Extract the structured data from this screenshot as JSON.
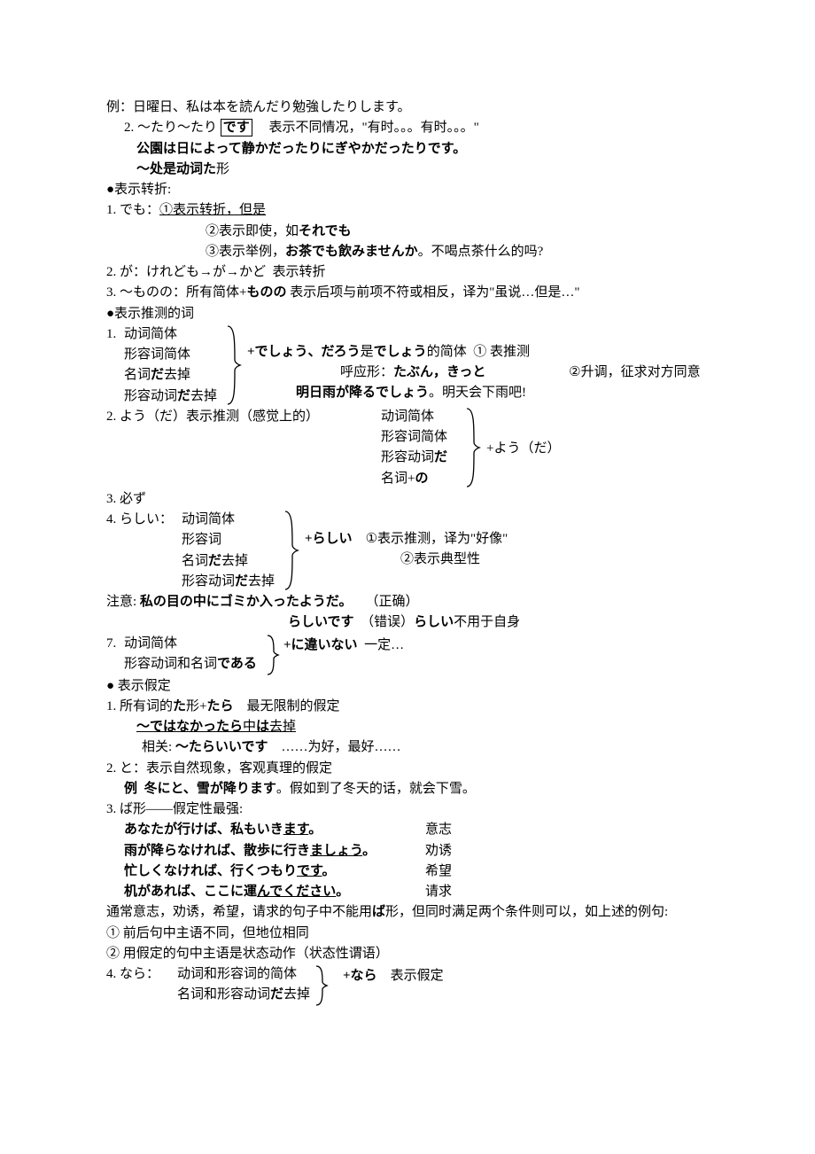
{
  "l1": "例：日曜日、私は本を読んだり勉強したりします。",
  "l2a": "2. ～たり～たり",
  "l2b": "です",
  "l2c": "表示不同情况，\"有时。。。有时。。。\"",
  "l3": "公園は日によって静かだったりにぎやかだったりです。",
  "l4a": "～处是动词",
  "l4b": "た",
  "l4c": "形",
  "sec1": "●表示转折:",
  "demo_head": "1. でも：",
  "demo1": "①表示转折，但是",
  "demo2a": "②表示即使，如",
  "demo2b": "それでも",
  "demo3a": "③表示举例，",
  "demo3b": "お茶でも飲みませんか",
  "demo3c": "。不喝点茶什么的吗?",
  "ga": "2. が：けれども→が→かど",
  "ga2": "表示转折",
  "monono1": "3. ～ものの：所有简体+",
  "monono2": "ものの",
  "monono3": "表示后项与前项不符或相反，译为\"虽说…但是…\"",
  "sec2": "●表示推测的词",
  "des_a": "动词简体",
  "des_b": "形容词简体",
  "des_c1": "名词",
  "des_c2": "だ",
  "des_c3": "去掉",
  "des_d1": "形容动词",
  "des_d2": "だ",
  "des_d3": "去掉",
  "des_r1a": "+でしょう、だろう",
  "des_r1b": "是",
  "des_r1c": "でしょう",
  "des_r1d": "的简体",
  "des_r1e": "① 表推测",
  "des_r2a": "呼应形：",
  "des_r2b": "たぶん，きっと",
  "des_r2c": "②升调，征求对方同意",
  "des_r3a": "明日雨が降るでしょう",
  "des_r3b": "。明天会下雨吧!",
  "yo_head": "2. よう（だ）表示推测（感觉上的）",
  "yo_a": "动词简体",
  "yo_b": "形容词简体",
  "yo_c1": "形容动词",
  "yo_c2": "だ",
  "yo_d1": "名词+",
  "yo_d2": "の",
  "yo_r": "+よう（だ）",
  "kana": "3. 必ず",
  "ra_head": "4. らしい：",
  "ra_a": "动词简体",
  "ra_b": "形容词",
  "ra_c1": "名词",
  "ra_c2": "だ",
  "ra_c3": "去掉",
  "ra_d1": "形容动词",
  "ra_d2": "だ",
  "ra_d3": "去掉",
  "ra_r1": "+らしい",
  "ra_r2": "①表示推测，译为\"好像\"",
  "ra_r3": "②表示典型性",
  "note1a": "注意:",
  "note1b": "私の目の中にゴミか入ったようだ。",
  "note1c": "（正确）",
  "note2a": "らしいです",
  "note2b": "（错误）",
  "note2c": "らしい",
  "note2d": "不用于自身",
  "chi_head": "7.",
  "chi_a": "动词简体",
  "chi_b1": "形容动词和名词",
  "chi_b2": "である",
  "chi_r": "+に違いない",
  "chi_r2": "一定…",
  "sec3": "● 表示假定",
  "tara1a": "1. 所有词的",
  "tara1b": "た",
  "tara1c": "形+",
  "tara1d": "たら",
  "tara1e": "最无限制的假定",
  "tara2a": "～ではなかったら",
  "tara2b": "中",
  "tara2c": "は",
  "tara2d": "去掉",
  "tara3a": "相关: ",
  "tara3b": "～たらいいです",
  "tara3c": "……为好，最好……",
  "to1": "2. と：表示自然现象，客观真理的假定",
  "to2a": "例",
  "to2b": "冬にと、雪が降ります",
  "to2c": "。假如到了冬天的话，就会下雪。",
  "ba_head": "3. ば形――假定性最强:",
  "ba1a": "あなたが行けば、私もいき",
  "ba1b": "ます",
  "ba1c": "。",
  "ba1d": "意志",
  "ba2a": "雨が降らなければ、散歩に行き",
  "ba2b": "ましょう",
  "ba2c": "。",
  "ba2d": "劝诱",
  "ba3a": "忙しくなければ、行くつもり",
  "ba3b": "です",
  "ba3c": "。",
  "ba3d": "希望",
  "ba4a": "机があれば、ここに運",
  "ba4b": "んでください",
  "ba4c": "。",
  "ba4d": "请求",
  "ba_note1a": "通常意志，劝诱，希望，请求的句子中不能用",
  "ba_note1b": "ば",
  "ba_note1c": "形，但同时满足两个条件则可以，如上述的例句:",
  "ba_cond1": "① 前后句中主语不同，但地位相同",
  "ba_cond2": "② 用假定的句中主语是状态动作（状态性谓语）",
  "nara_head": "4. なら：",
  "nara_a": "动词和形容词的简体",
  "nara_b1": "名词和形容动词",
  "nara_b2": "だ",
  "nara_b3": "去掉",
  "nara_r1": "+なら",
  "nara_r2": "表示假定"
}
